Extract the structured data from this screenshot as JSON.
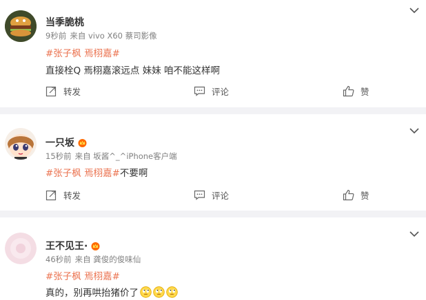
{
  "posts": [
    {
      "username": "当季脆桃",
      "time": "9秒前",
      "source": "来自 vivo X60 蔡司影像",
      "tags": [
        "#张子枫",
        "焉栩嘉#"
      ],
      "text": "直接栓Q 焉栩嘉滚远点 妹妹 咱不能这样啊",
      "actions": {
        "repost": "转发",
        "comment": "评论",
        "like": "赞"
      }
    },
    {
      "username": "一只坂",
      "time": "15秒前",
      "source": "来自 坂酱^_^iPhone客户端",
      "tags": [
        "#张子枫",
        "焉栩嘉#"
      ],
      "text": "不要啊",
      "actions": {
        "repost": "转发",
        "comment": "评论",
        "like": "赞"
      }
    },
    {
      "username": "王不见王·",
      "time": "46秒前",
      "source": "来自 龚俊的俊味仙",
      "tags": [
        "#张子枫",
        "焉栩嘉#"
      ],
      "text": "真的，别再哄抬猪价了",
      "emoji_count": 3
    }
  ],
  "colors": {
    "tag": "#eb7350",
    "vip_badge": "#ff6a00",
    "separator": "#f2f2f5"
  },
  "icons": [
    "repost-icon",
    "comment-icon",
    "like-icon",
    "chevron-down-icon",
    "vip-crown-icon",
    "emoji-icon"
  ]
}
